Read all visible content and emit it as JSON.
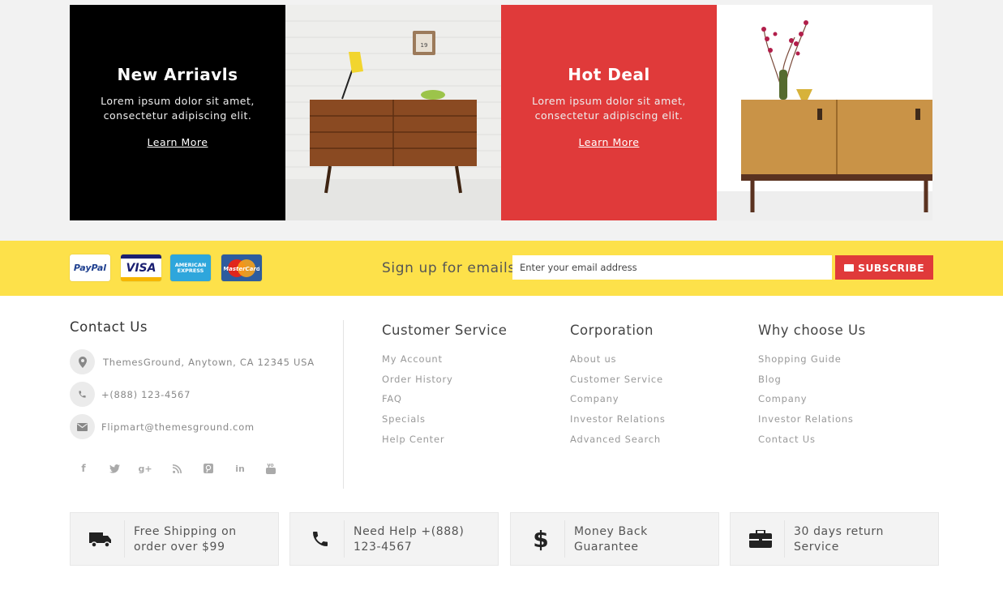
{
  "banner": {
    "new_title": "New Arriavls",
    "new_text": "Lorem ipsum dolor sit amet, consectetur adipiscing elit.",
    "new_link": "Learn More",
    "hot_title": "Hot Deal",
    "hot_text": "Lorem ipsum dolor sit amet, consectetur adipiscing elit.",
    "hot_link": "Learn More",
    "wall_clock_number": "19"
  },
  "payments": {
    "paypal": "PayPal",
    "visa": "VISA",
    "amex_line1": "AMERICAN",
    "amex_line2": "EXPRESS",
    "mastercard": "MasterCard"
  },
  "signup": {
    "label": "Sign up for emails",
    "placeholder": "Enter your email address",
    "button": "SUBSCRIBE"
  },
  "contact": {
    "title": "Contact Us",
    "address": "ThemesGround, Anytown, CA 12345 USA",
    "phone": "+(888) 123-4567",
    "email": "Flipmart@themesground.com"
  },
  "columns": [
    {
      "title": "Customer Service",
      "items": [
        "My Account",
        "Order History",
        "FAQ",
        "Specials",
        "Help Center"
      ]
    },
    {
      "title": "Corporation",
      "items": [
        "About us",
        "Customer Service",
        "Company",
        "Investor Relations",
        "Advanced Search"
      ]
    },
    {
      "title": "Why choose Us",
      "items": [
        "Shopping Guide",
        "Blog",
        "Company",
        "Investor Relations",
        "Contact Us"
      ]
    }
  ],
  "info_boxes": [
    {
      "icon": "truck-icon",
      "text": "Free Shipping on order over $99"
    },
    {
      "icon": "phone-icon",
      "text": "Need Help +(888) 123-4567"
    },
    {
      "icon": "dollar-icon",
      "text": "Money Back Guarantee"
    },
    {
      "icon": "briefcase-icon",
      "text": "30 days return Service"
    }
  ],
  "colors": {
    "accent_red": "#e03a3a",
    "signup_yellow": "#fde14a",
    "black_tile": "#000000"
  }
}
